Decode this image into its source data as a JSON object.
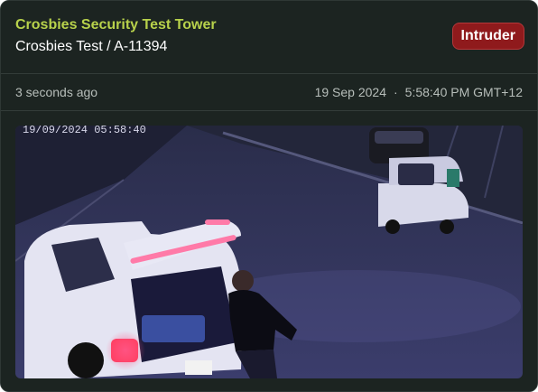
{
  "event": {
    "site_title": "Crosbies Security Test Tower",
    "camera": "Crosbies Test / A-11394",
    "badge": "Intruder",
    "relative_time": "3 seconds ago",
    "date": "19 Sep 2024",
    "separator": "·",
    "time": "5:58:40 PM GMT+12"
  },
  "snapshot": {
    "overlay_timestamp": "19/09/2024  05:58:40",
    "alt": "Security camera snapshot"
  },
  "colors": {
    "accent": "#b8d24b",
    "alert": "#8f1a1c",
    "card_bg": "#1c2421"
  }
}
